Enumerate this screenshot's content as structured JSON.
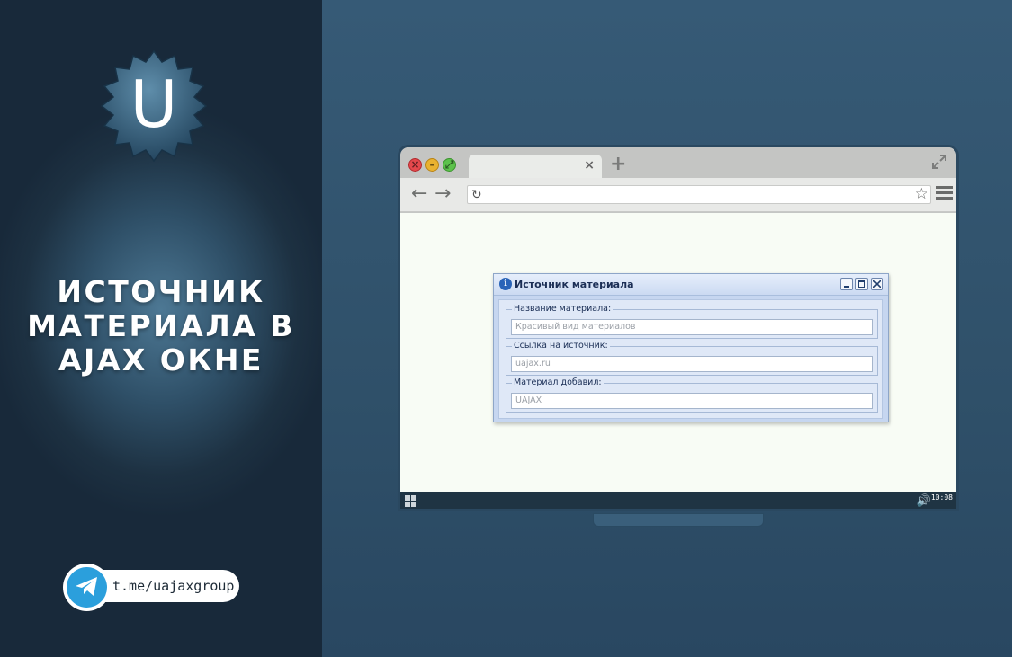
{
  "promo": {
    "logo_letter": "U",
    "headline_lines": [
      "ИСТОЧНИК",
      "МАТЕРИАЛА В",
      "AJAX ОКНЕ"
    ],
    "telegram_link": "t.me/uajaxgroup"
  },
  "browser": {
    "tab_close": "×",
    "new_tab": "+",
    "nav_back": "←",
    "nav_forward": "→",
    "reload": "↻",
    "bookmark": "☆",
    "clock": "10:08"
  },
  "ajax_window": {
    "title": "Источник материала",
    "info_glyph": "i",
    "fields": [
      {
        "label": "Название материала:",
        "value": "Красивый вид материалов"
      },
      {
        "label": "Ссылка на источник:",
        "value": "uajax.ru"
      },
      {
        "label": "Материал добавил:",
        "value": "UAJAX"
      }
    ]
  },
  "colors": {
    "left_panel": "#1d3142",
    "right_panel": "#2f5069",
    "telegram_blue": "#2b9fdc",
    "window_frame": "#c6d6f0",
    "window_title_text": "#1b2e55"
  }
}
